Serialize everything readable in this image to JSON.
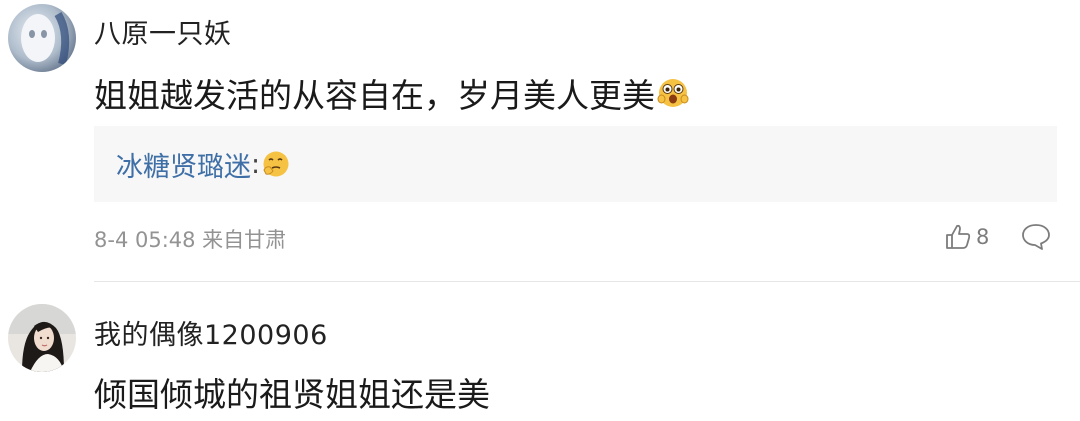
{
  "comments": [
    {
      "username": "八原一只妖",
      "avatar_icon": "ghost-face-avatar",
      "text": "姐姐越发活的从容自在，岁月美人更美",
      "text_emoji": "shocked-face-emoji",
      "reply": {
        "username": "冰糖贤璐迷",
        "colon": ":",
        "emoji": "thinking-face-emoji"
      },
      "meta": "8-4 05:48 来自甘肃",
      "like_icon": "thumbs-up-icon",
      "likes": "8",
      "reply_icon": "comment-bubble-icon"
    },
    {
      "username": "我的偶像1200906",
      "avatar_icon": "woman-portrait-avatar",
      "text": "倾国倾城的祖贤姐姐还是美"
    }
  ],
  "colors": {
    "reply_username": "#3f6fa7",
    "meta": "#939393",
    "reply_bg": "#f7f7f7",
    "divider": "#e6e6e6"
  }
}
